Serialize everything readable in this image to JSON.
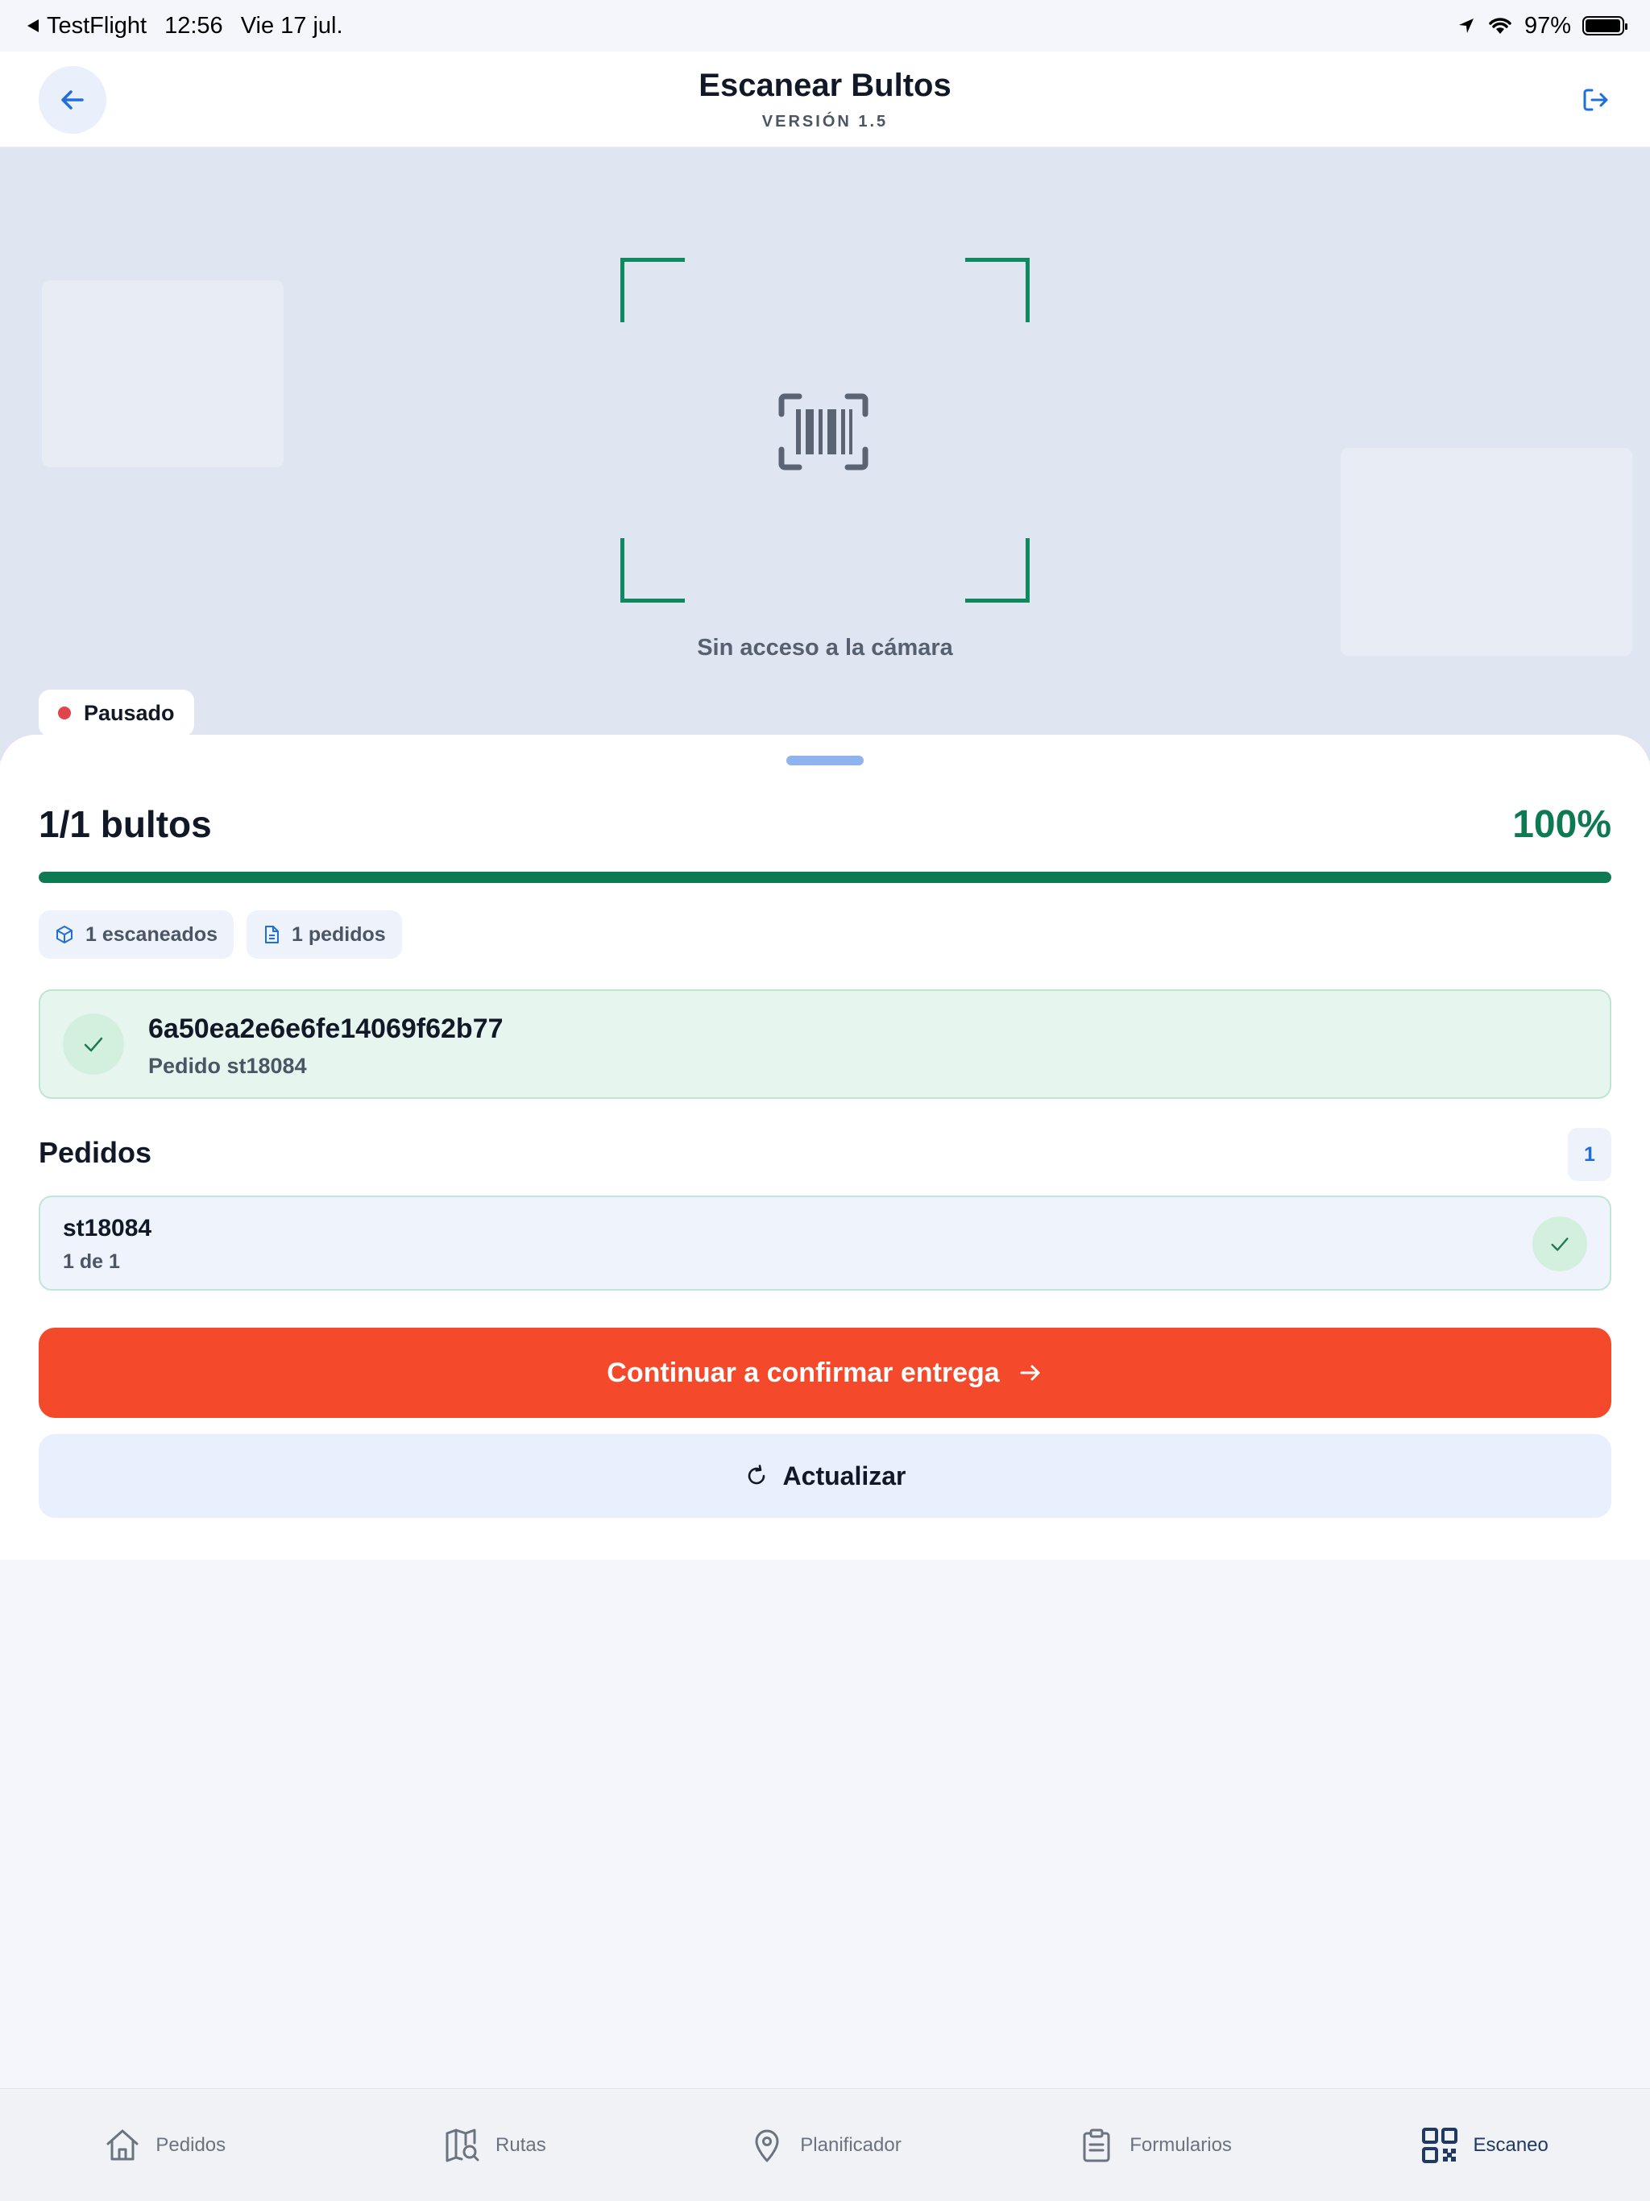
{
  "status_bar": {
    "app_back": "TestFlight",
    "time": "12:56",
    "date": "Vie 17 jul.",
    "battery": "97%",
    "battery_level": 0.97
  },
  "header": {
    "title": "Escanear Bultos",
    "subtitle": "VERSIÓN 1.5"
  },
  "camera": {
    "no_access": "Sin acceso a la cámara",
    "status": "Pausado"
  },
  "summary": {
    "count": "1/1 bultos",
    "percent": "100%",
    "progress": 1.0,
    "chips": [
      {
        "icon": "box-icon",
        "label": "1 escaneados"
      },
      {
        "icon": "document-icon",
        "label": "1 pedidos"
      }
    ]
  },
  "last_scan": {
    "code": "6a50ea2e6e6fe14069f62b77",
    "order": "Pedido st18084"
  },
  "pedidos": {
    "title": "Pedidos",
    "count": "1",
    "items": [
      {
        "id": "st18084",
        "progress": "1 de 1"
      }
    ]
  },
  "actions": {
    "continue_label": "Continuar a confirmar entrega",
    "refresh_label": "Actualizar"
  },
  "tabs": [
    {
      "label": "Pedidos",
      "icon": "home-icon"
    },
    {
      "label": "Rutas",
      "icon": "map-search-icon"
    },
    {
      "label": "Planificador",
      "icon": "location-pin-icon"
    },
    {
      "label": "Formularios",
      "icon": "clipboard-icon"
    },
    {
      "label": "Escaneo",
      "icon": "qr-code-icon",
      "active": true
    }
  ],
  "colors": {
    "accent_green": "#0d7a52",
    "primary_orange": "#f4492a",
    "link_blue": "#1e6fd9",
    "paused_red": "#e0454a"
  }
}
